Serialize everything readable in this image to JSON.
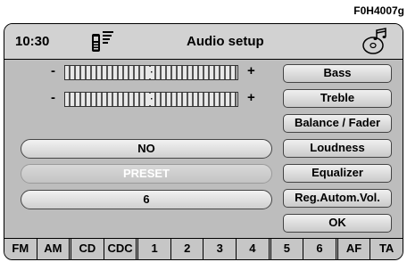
{
  "ref_code": "F0H4007g",
  "header": {
    "time": "10:30",
    "title": "Audio setup"
  },
  "sliders": [
    {
      "minus": "-",
      "plus": "+",
      "marker": "·",
      "level": 0.5
    },
    {
      "minus": "-",
      "plus": "+",
      "marker": "·",
      "level": 0.5
    }
  ],
  "fields": [
    {
      "label": "NO",
      "enabled": true
    },
    {
      "label": "PRESET",
      "enabled": false
    },
    {
      "label": "6",
      "enabled": true
    }
  ],
  "menu": [
    "Bass",
    "Treble",
    "Balance / Fader",
    "Loudness",
    "Equalizer",
    "Reg.Autom.Vol.",
    "OK"
  ],
  "bottom_bar": [
    "FM",
    "AM",
    "CD",
    "CDC",
    "1",
    "2",
    "3",
    "4",
    "5",
    "6",
    "AF",
    "TA"
  ]
}
